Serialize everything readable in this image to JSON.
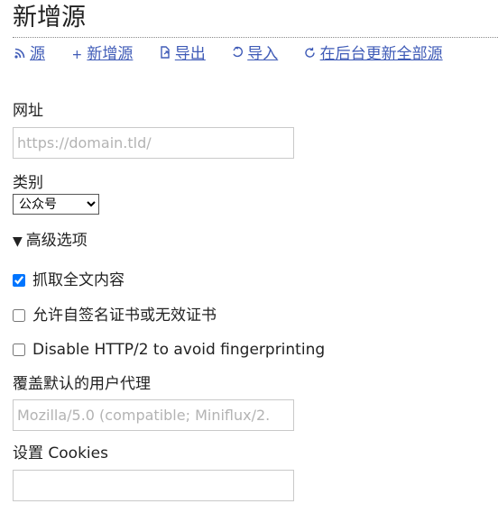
{
  "page": {
    "title": "新增源"
  },
  "nav": [
    {
      "icon": "rss-icon",
      "glyph": ")",
      "label": "源"
    },
    {
      "icon": "plus-icon",
      "glyph": "+",
      "label": "新增源"
    },
    {
      "icon": "export-icon",
      "glyph": "↱",
      "label": "导出"
    },
    {
      "icon": "import-icon",
      "glyph": "↳",
      "label": "导入"
    },
    {
      "icon": "refresh-icon",
      "glyph": "↻",
      "label": "在后台更新全部源"
    }
  ],
  "form": {
    "url": {
      "label": "网址",
      "placeholder": "https://domain.tld/",
      "value": ""
    },
    "category": {
      "label": "类别",
      "selected": "公众号"
    },
    "advanced": {
      "label": "高级选项",
      "expanded": true
    },
    "crawler": {
      "label": "抓取全文内容",
      "checked": true
    },
    "allow_self_signed": {
      "label": "允许自签名证书或无效证书",
      "checked": false
    },
    "disable_http2": {
      "label": "Disable HTTP/2 to avoid fingerprinting",
      "checked": false
    },
    "user_agent": {
      "label": "覆盖默认的用户代理",
      "placeholder": "Mozilla/5.0 (compatible; Miniflux/2.",
      "value": ""
    },
    "cookies": {
      "label": "设置 Cookies",
      "value": ""
    }
  },
  "colors": {
    "link": "#3f5bb7",
    "text": "#222222",
    "border": "#c9c9c9",
    "placeholder": "#b3b3b3"
  }
}
